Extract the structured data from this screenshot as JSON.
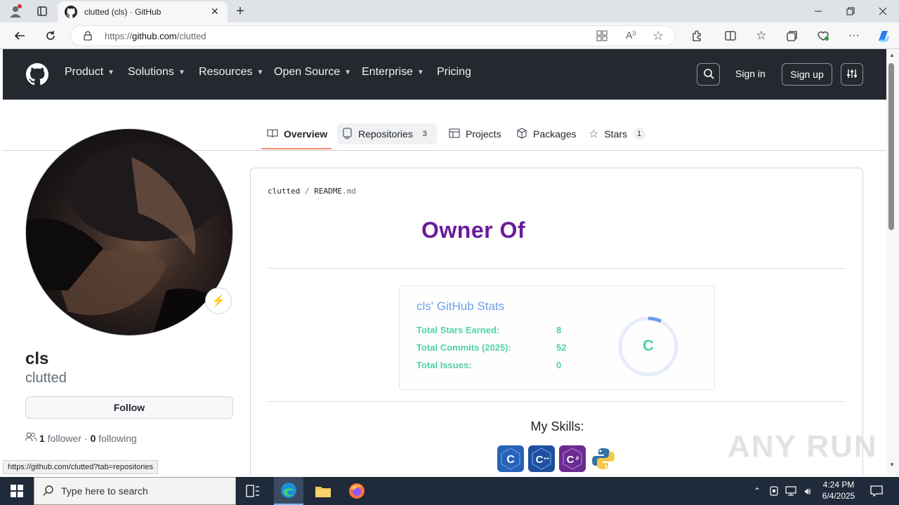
{
  "browser": {
    "tab_title": "clutted (cls) · GitHub",
    "url_protocol": "https://",
    "url_host": "github.com",
    "url_path": "/clutted",
    "status_url": "https://github.com/clutted?tab=repositories"
  },
  "gh_header": {
    "nav": [
      "Product",
      "Solutions",
      "Resources",
      "Open Source",
      "Enterprise",
      "Pricing"
    ],
    "sign_in": "Sign in",
    "sign_up": "Sign up"
  },
  "profile_tabs": [
    {
      "label": "Overview",
      "icon": "book-icon"
    },
    {
      "label": "Repositories",
      "icon": "repo-icon",
      "count": "3"
    },
    {
      "label": "Projects",
      "icon": "table-icon"
    },
    {
      "label": "Packages",
      "icon": "package-icon"
    },
    {
      "label": "Stars",
      "icon": "star-icon",
      "count": "1"
    }
  ],
  "profile": {
    "name": "cls",
    "login": "clutted",
    "follow_label": "Follow",
    "followers_count": "1",
    "followers_label": "follower",
    "separator": "·",
    "following_count": "0",
    "following_label": "following"
  },
  "readme": {
    "path_user": "clutted",
    "path_sep": "/",
    "path_file": "README",
    "path_ext": ".md",
    "heading": "Owner Of",
    "stats_title": "cls' GitHub Stats",
    "stats": [
      {
        "label": "Total Stars Earned:",
        "value": "8"
      },
      {
        "label": "Total Commits (2025):",
        "value": "52"
      },
      {
        "label": "Total Issues:",
        "value": "0"
      }
    ],
    "rank": "C",
    "skills_heading": "My Skills:",
    "skills": [
      "C",
      "C++",
      "C#",
      "Python"
    ]
  },
  "taskbar": {
    "search_placeholder": "Type here to search",
    "time": "4:24 PM",
    "date": "6/4/2025"
  },
  "watermark": "ANY RUN",
  "colors": {
    "header_bg": "#24292f",
    "stats_title": "#6d9eeb",
    "stats_text": "#4fd1a6",
    "heading": "#6a1b9a",
    "tab_underline": "#fd8c73"
  }
}
